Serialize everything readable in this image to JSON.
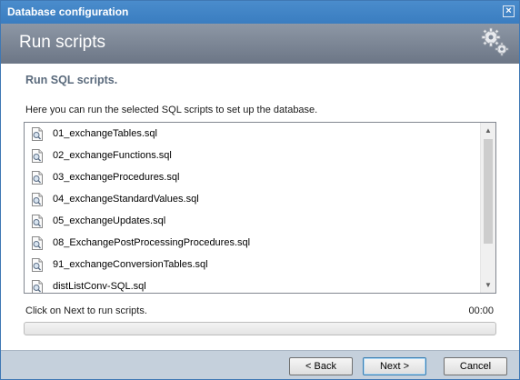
{
  "window": {
    "title": "Database configuration",
    "close_glyph": "×"
  },
  "header": {
    "title": "Run scripts",
    "icon": "gears-icon"
  },
  "main": {
    "section_title": "Run SQL scripts.",
    "instructions": "Here you can run the selected SQL scripts to set up the database.",
    "scripts": [
      "01_exchangeTables.sql",
      "02_exchangeFunctions.sql",
      "03_exchangeProcedures.sql",
      "04_exchangeStandardValues.sql",
      "05_exchangeUpdates.sql",
      "08_ExchangePostProcessingProcedures.sql",
      "91_exchangeConversionTables.sql",
      "distListConv-SQL.sql"
    ],
    "status_text": "Click on Next to run scripts.",
    "timer": "00:00",
    "progress_fraction": 0
  },
  "footer": {
    "back_label": "< Back",
    "next_label": "Next >",
    "cancel_label": "Cancel"
  },
  "colors": {
    "titlebar": "#3f80c4",
    "header_band": "#7b8696",
    "section_title": "#5a6a7c",
    "footer": "#c5d0dc"
  }
}
